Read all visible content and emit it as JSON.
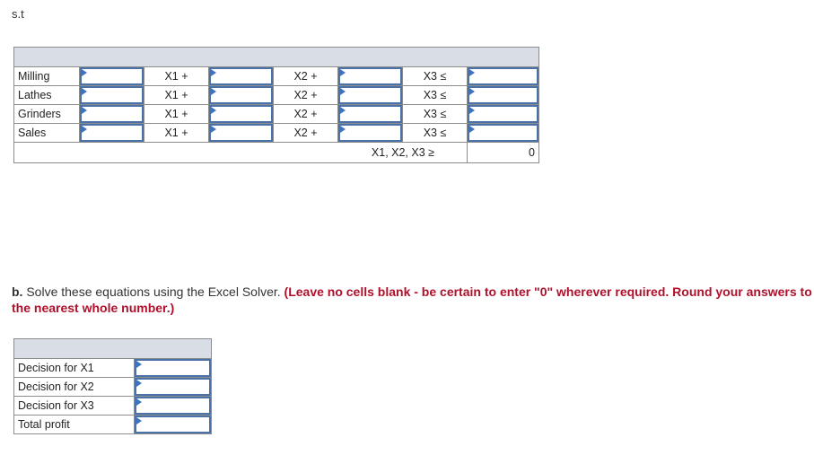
{
  "subject_to_label": "s.t",
  "constraints_table": {
    "rows": [
      {
        "label": "Milling",
        "x1_text": "X1 +",
        "x2_text": "X2 +",
        "x3_text": "X3 ≤"
      },
      {
        "label": "Lathes",
        "x1_text": "X1 +",
        "x2_text": "X2 +",
        "x3_text": "X3 ≤"
      },
      {
        "label": "Grinders",
        "x1_text": "X1 +",
        "x2_text": "X2 +",
        "x3_text": "X3 ≤"
      },
      {
        "label": "Sales",
        "x1_text": "X1 +",
        "x2_text": "X2 +",
        "x3_text": "X3 ≤"
      }
    ],
    "nonnegativity_text": "X1, X2, X3 ≥",
    "nonnegativity_value": "0"
  },
  "part_b": {
    "prefix": "b.",
    "text": " Solve these equations using the Excel Solver. ",
    "instruction": "(Leave no cells blank - be certain to enter \"0\" wherever required. Round your answers to the nearest whole number.)"
  },
  "results_table": {
    "rows": [
      {
        "label": "Decision for X1",
        "value": ""
      },
      {
        "label": "Decision for X2",
        "value": ""
      },
      {
        "label": "Decision for X3",
        "value": ""
      },
      {
        "label": "Total profit",
        "value": ""
      }
    ]
  },
  "colors": {
    "header_bg": "#d9dde6",
    "input_border": "#4a72a8",
    "instruction_red": "#b0102b"
  }
}
